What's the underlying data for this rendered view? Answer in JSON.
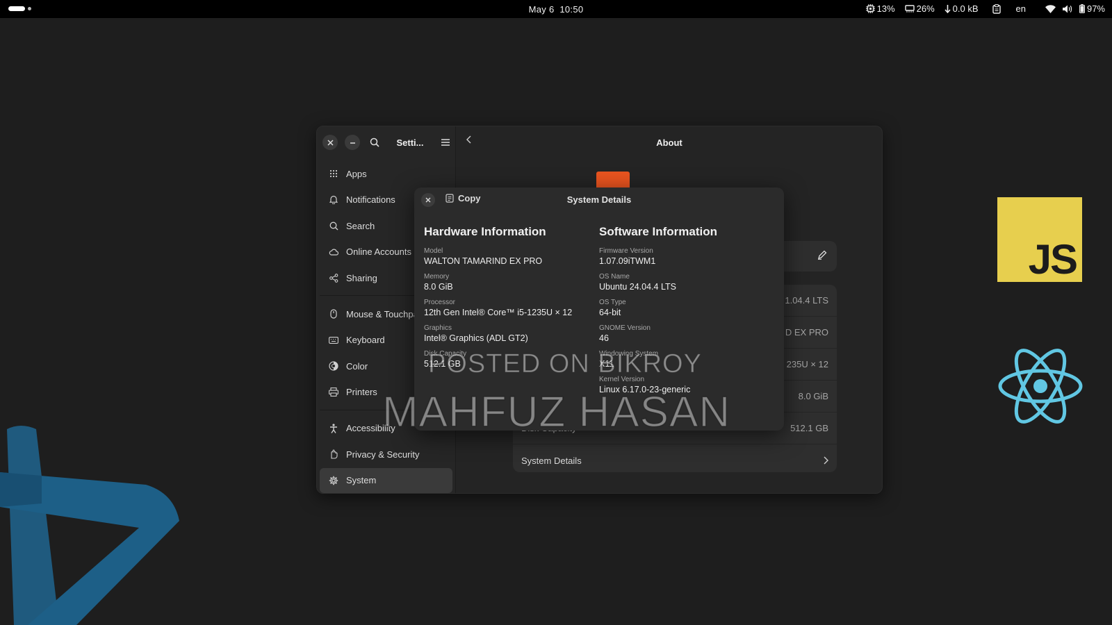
{
  "topbar": {
    "date": "May 6",
    "time": "10:50",
    "cpu": "13%",
    "memory": "26%",
    "network": "0.0 kB",
    "language": "en",
    "battery": "97%"
  },
  "desktop": {
    "js_logo_text": "JS"
  },
  "settings": {
    "sidebar_title": "Setti...",
    "content_title": "About",
    "sidebar_items": [
      {
        "label": "Apps",
        "icon": "apps-grid-icon"
      },
      {
        "label": "Notifications",
        "icon": "bell-icon"
      },
      {
        "label": "Search",
        "icon": "search-icon"
      },
      {
        "label": "Online Accounts",
        "icon": "cloud-icon"
      },
      {
        "label": "Sharing",
        "icon": "share-icon"
      },
      {
        "label": "Mouse & Touchpad",
        "icon": "mouse-icon"
      },
      {
        "label": "Keyboard",
        "icon": "keyboard-icon"
      },
      {
        "label": "Color",
        "icon": "color-icon"
      },
      {
        "label": "Printers",
        "icon": "printer-icon"
      },
      {
        "label": "Accessibility",
        "icon": "accessibility-icon"
      },
      {
        "label": "Privacy & Security",
        "icon": "hand-icon"
      },
      {
        "label": "System",
        "icon": "gear-icon"
      }
    ],
    "about_rows": [
      {
        "label": "",
        "value": "1.04.4 LTS"
      },
      {
        "label": "",
        "value": "D EX PRO"
      },
      {
        "label": "",
        "value": "235U × 12"
      },
      {
        "label": "",
        "value": "8.0 GiB"
      },
      {
        "label": "Disk Capacity",
        "value": "512.1 GB"
      }
    ],
    "system_details_label": "System Details"
  },
  "dialog": {
    "title": "System Details",
    "copy_label": "Copy",
    "hardware": {
      "heading": "Hardware Information",
      "fields": [
        {
          "label": "Model",
          "value": "WALTON TAMARIND EX PRO"
        },
        {
          "label": "Memory",
          "value": "8.0 GiB"
        },
        {
          "label": "Processor",
          "value": "12th Gen Intel® Core™ i5-1235U × 12"
        },
        {
          "label": "Graphics",
          "value": "Intel® Graphics (ADL GT2)"
        },
        {
          "label": "Disk Capacity",
          "value": "512.1 GB"
        }
      ]
    },
    "software": {
      "heading": "Software Information",
      "fields": [
        {
          "label": "Firmware Version",
          "value": "1.07.09iTWM1"
        },
        {
          "label": "OS Name",
          "value": "Ubuntu 24.04.4 LTS"
        },
        {
          "label": "OS Type",
          "value": "64-bit"
        },
        {
          "label": "GNOME Version",
          "value": "46"
        },
        {
          "label": "Windowing System",
          "value": "X11"
        },
        {
          "label": "Kernel Version",
          "value": "Linux 6.17.0-23-generic"
        }
      ]
    }
  },
  "watermark": {
    "line1": "POSTED ON BIKROY",
    "line2": "MAHFUZ HASAN"
  }
}
